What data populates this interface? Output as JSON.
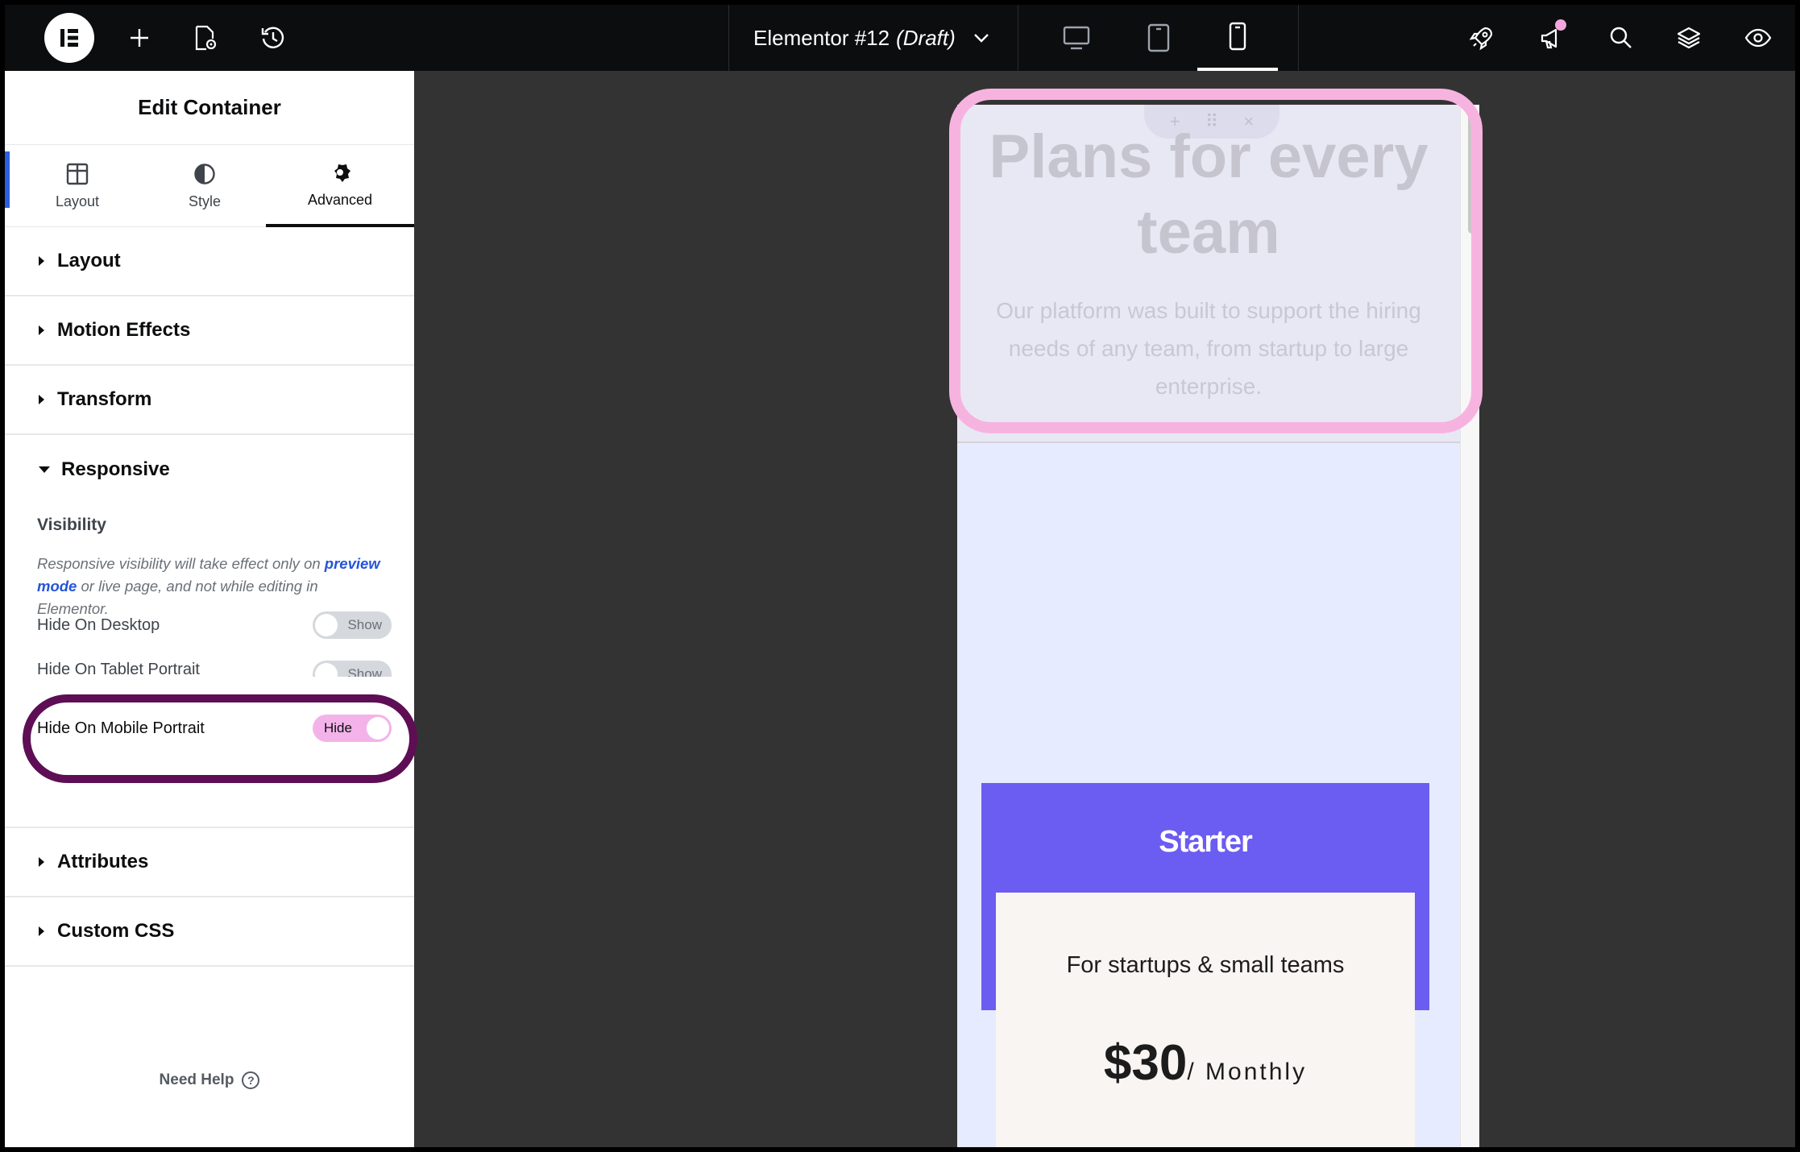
{
  "topbar": {
    "document_title": "Elementor #12",
    "document_status": "(Draft)"
  },
  "panel": {
    "title": "Edit Container",
    "tabs": [
      {
        "label": "Layout"
      },
      {
        "label": "Style"
      },
      {
        "label": "Advanced"
      }
    ],
    "sections": {
      "layout": "Layout",
      "motion_effects": "Motion Effects",
      "transform": "Transform",
      "responsive": "Responsive",
      "attributes": "Attributes",
      "custom_css": "Custom CSS"
    },
    "responsive": {
      "visibility_label": "Visibility",
      "note_before": "Responsive visibility will take effect only on ",
      "note_link": "preview mode",
      "note_after": " or live page, and not while editing in Elementor.",
      "rows": [
        {
          "label": "Hide On Desktop",
          "toggle": "Show"
        },
        {
          "label": "Hide On Tablet Portrait",
          "toggle": "Show"
        },
        {
          "label": "Hide On Mobile Portrait",
          "toggle": "Hide"
        }
      ]
    },
    "need_help": "Need Help",
    "help_icon": "?"
  },
  "canvas": {
    "hero_title": "Plans for every team",
    "hero_subtitle": "Our platform was built to support the hiring needs of any team, from startup to large enterprise.",
    "plan": {
      "name": "Starter",
      "tagline": "For startups & small teams",
      "price": "$30",
      "period": "/ Monthly"
    }
  },
  "colors": {
    "accent_purple": "#6b5cf2",
    "highlight_pink": "#f7b3df",
    "highlight_dark": "#5e0e54",
    "link_blue": "#2454d8"
  }
}
